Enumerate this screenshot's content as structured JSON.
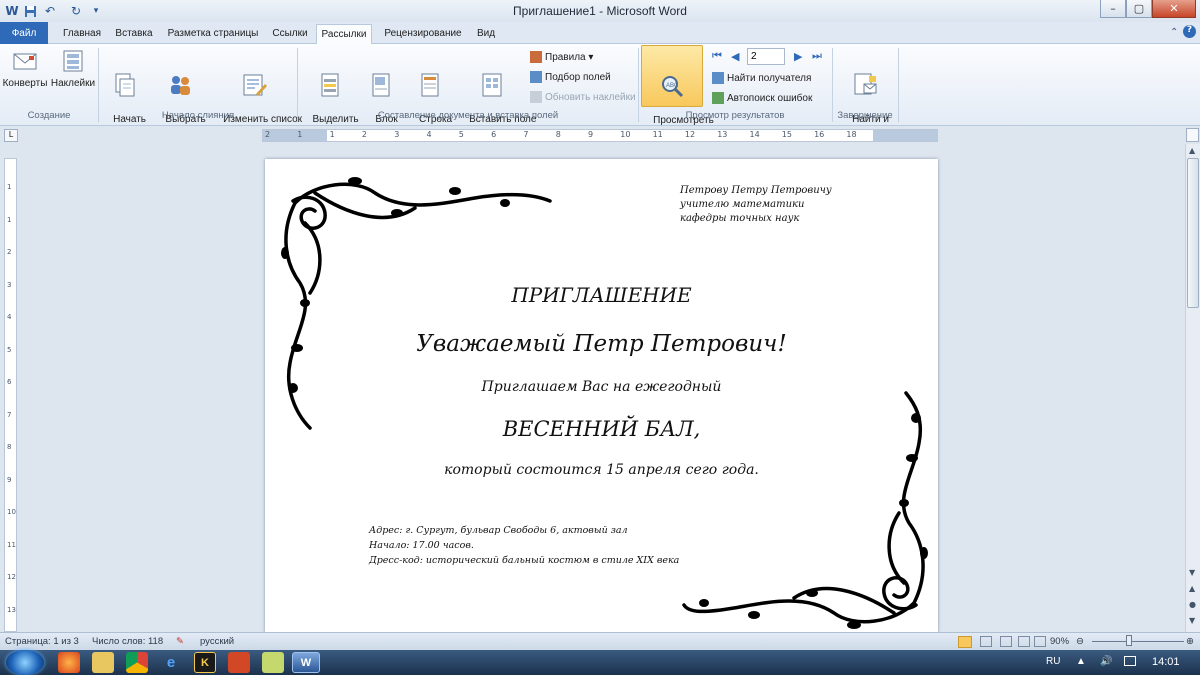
{
  "window": {
    "title": "Приглашение1 - Microsoft Word",
    "minimize_glyph": "–",
    "maximize_glyph": "▢",
    "close_glyph": "✕"
  },
  "quick_access": {
    "save_icon": "save-icon",
    "undo_icon": "undo-icon",
    "redo_icon": "redo-icon",
    "customize_icon": "customize-quick-access-icon"
  },
  "tabs": [
    "Файл",
    "Главная",
    "Вставка",
    "Разметка страницы",
    "Ссылки",
    "Рассылки",
    "Рецензирование",
    "Вид"
  ],
  "active_tab": "Рассылки",
  "ribbon": {
    "groups": [
      {
        "label": "Создание",
        "buttons": [
          "Конверты",
          "Наклейки"
        ]
      },
      {
        "label": "Начало слияния",
        "buttons": [
          "Начать\nслияние ▾",
          "Выбрать\nполучателей ▾",
          "Изменить список\nполучателей"
        ]
      },
      {
        "label": "Составление документа и вставка полей",
        "buttons": [
          "Выделить\nполя слияния",
          "Блок\nадреса",
          "Строка\nприветствия",
          "Вставить поле\nслияния ▾"
        ],
        "small": [
          "Правила ▾",
          "Подбор полей",
          "Обновить наклейки"
        ]
      },
      {
        "label": "Просмотр результатов",
        "buttons": [
          "Просмотреть\nрезультаты"
        ],
        "small": [
          "Найти получателя",
          "Автопоиск ошибок"
        ],
        "record": "2"
      },
      {
        "label": "Завершение",
        "buttons": [
          "Найти и\nобъединить ▾"
        ]
      }
    ]
  },
  "ruler": {
    "h_numbers": [
      "2",
      "1",
      "1",
      "2",
      "3",
      "4",
      "5",
      "6",
      "7",
      "8",
      "9",
      "10",
      "11",
      "12",
      "13",
      "14",
      "15",
      "16",
      "18"
    ],
    "v_numbers": [
      "1",
      "1",
      "2",
      "3",
      "4",
      "5",
      "6",
      "7",
      "8",
      "9",
      "10",
      "11",
      "12",
      "13"
    ]
  },
  "document": {
    "addressee": [
      "Петрову Петру Петровичу",
      "учителю математики",
      "кафедры точных наук"
    ],
    "heading": "ПРИГЛАШЕНИЕ",
    "greeting": "Уважаемый Петр Петрович!",
    "line1": "Приглашаем Вас на ежегодный",
    "event": "ВЕСЕННИЙ БАЛ,",
    "line2": "который состоится 15 апреля сего года.",
    "details": [
      "Адрес: г. Сургут, бульвар Свободы 6, актовый зал",
      "Начало: 17.00 часов.",
      "Дресс-код: исторический бальный костюм в стиле XIX века"
    ]
  },
  "status": {
    "page": "Страница: 1 из 3",
    "words": "Число слов: 118",
    "language": "русский",
    "zoom": "90%"
  },
  "taskbar": {
    "apps": [
      "firefox-icon",
      "explorer-icon",
      "chrome-icon",
      "ie-icon",
      "kaspersky-icon",
      "powerpoint-icon",
      "notes-icon",
      "word-icon"
    ],
    "kaspersky_letter": "K",
    "word_letter": "W",
    "lang": "RU",
    "time": "14:01"
  },
  "colors": {
    "accent": "#2f6ab8",
    "ribbon_bg": "#fbfcfe",
    "preview_highlight": "#f8c85c"
  }
}
